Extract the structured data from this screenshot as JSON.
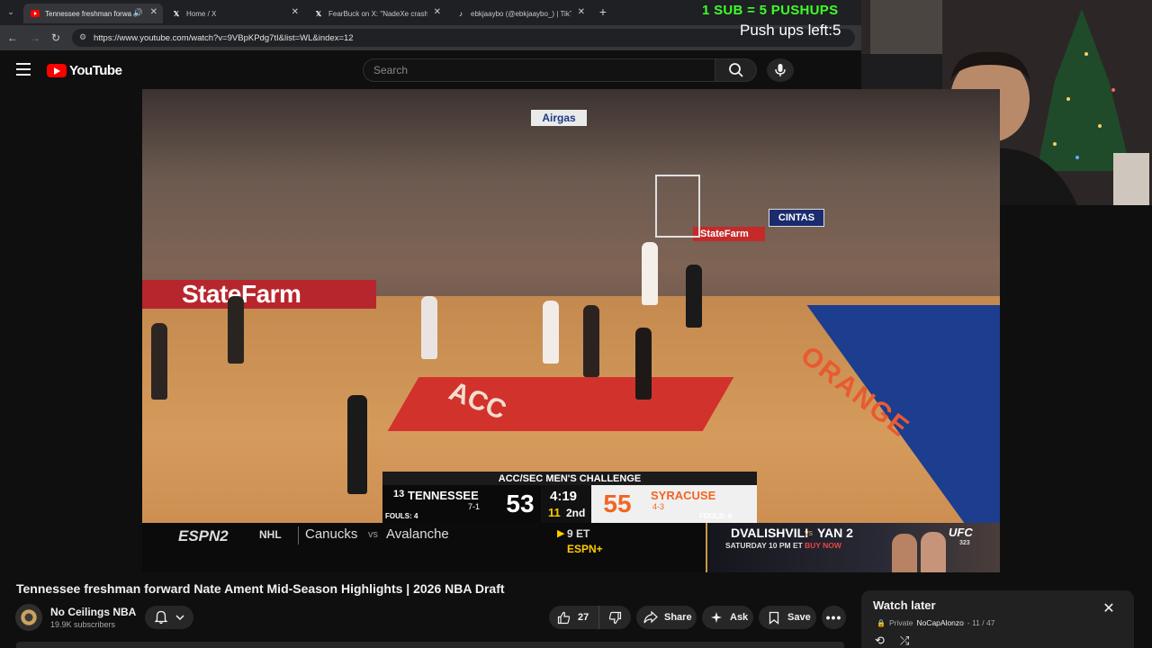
{
  "browser": {
    "tabs": [
      {
        "title": "Tennessee freshman forwa",
        "active": true,
        "icon": "youtube-icon"
      },
      {
        "title": "Home / X",
        "active": false,
        "icon": "x-logo-icon"
      },
      {
        "title": "FearBuck on X: \"NadeXe crashe",
        "active": false,
        "icon": "x-logo-icon"
      },
      {
        "title": "ebkjaaybo (@ebkjaaybo_) | TikT",
        "active": false,
        "icon": "tiktok-icon"
      }
    ],
    "url": "https://www.youtube.com/watch?v=9VBpKPdg7tI&list=WL&index=12"
  },
  "stream_overlay": {
    "banner": "1 SUB = 5 PUSHUPS",
    "pushups_left": "Push ups left:5"
  },
  "youtube": {
    "logo_text": "YouTube",
    "search_placeholder": "Search"
  },
  "video_frame": {
    "arena_signs": {
      "airgas": "Airgas",
      "cintas": "CINTAS",
      "state_farm_large": "StateFarm",
      "state_farm_small": "StateFarm",
      "acc": "ACC",
      "orange": "ORANGE"
    },
    "scorebug": {
      "event": "ACC/SEC MEN'S CHALLENGE",
      "away_rank": "13",
      "away_team": "TENNESSEE",
      "away_record": "7-1",
      "away_fouls": "FOULS: 4",
      "away_score": "53",
      "clock": "4:19",
      "period_num": "11",
      "period": "2nd",
      "home_score": "55",
      "home_team": "SYRACUSE",
      "home_record": "4-3",
      "home_fouls": "FOULS: 6"
    },
    "ticker": {
      "network": "ESPN2",
      "league": "NHL",
      "team_a": "Canucks",
      "vs": "vs",
      "team_b": "Avalanche",
      "time": "9 ET",
      "channel": "ESPN+"
    },
    "ufc_ad": {
      "fighter_a": "DVALISHVILI",
      "vs": "vs",
      "fighter_b": "YAN 2",
      "when": "SATURDAY 10 PM ET",
      "cta": "BUY NOW",
      "brand": "UFC",
      "event_num": "323"
    }
  },
  "video": {
    "title": "Tennessee freshman forward Nate Ament Mid-Season Highlights | 2026 NBA Draft",
    "channel": "No Ceilings NBA",
    "subscribers": "19.9K subscribers",
    "like_count": "27",
    "share_label": "Share",
    "ask_label": "Ask",
    "save_label": "Save"
  },
  "playlist": {
    "title": "Watch later",
    "privacy": "Private",
    "owner": "NoCapAlonzo",
    "position": "- 11 / 47"
  },
  "colors": {
    "accent_green": "#3cff28",
    "youtube_red": "#ff0000",
    "syracuse_orange": "#f26522",
    "tennessee_orange": "#ff8200"
  }
}
